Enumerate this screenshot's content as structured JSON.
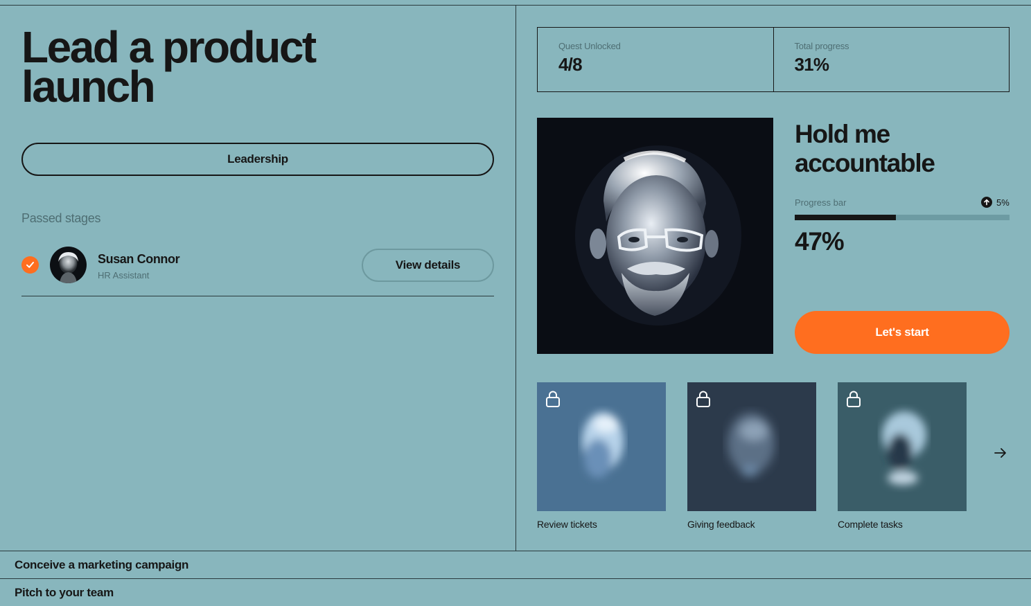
{
  "quest": {
    "title": "Lead a product launch",
    "category": "Leadership"
  },
  "passed_stages": {
    "label": "Passed stages",
    "items": [
      {
        "name": "Susan Connor",
        "role": "HR Assistant",
        "action": "View details"
      }
    ]
  },
  "stats": [
    {
      "label": "Quest Unlocked",
      "value": "4/8"
    },
    {
      "label": "Total progress",
      "value": "31%"
    }
  ],
  "current_stage": {
    "title": "Hold me accountable",
    "progress_label": "Progress bar",
    "progress_change": "5%",
    "progress_text": "47%",
    "progress_fraction": 0.47,
    "cta": "Let's start"
  },
  "locked_stages": [
    {
      "label": "Review tickets",
      "color": "#4a7193"
    },
    {
      "label": "Giving feedback",
      "color": "#2c3a4b"
    },
    {
      "label": "Complete tasks",
      "color": "#3a5d68"
    }
  ],
  "other_quests": [
    {
      "label": "Conceive a marketing campaign"
    },
    {
      "label": "Pitch to your team"
    }
  ],
  "colors": {
    "background": "#88b6bd",
    "accent": "#ff6e1f",
    "ink": "#161616"
  }
}
